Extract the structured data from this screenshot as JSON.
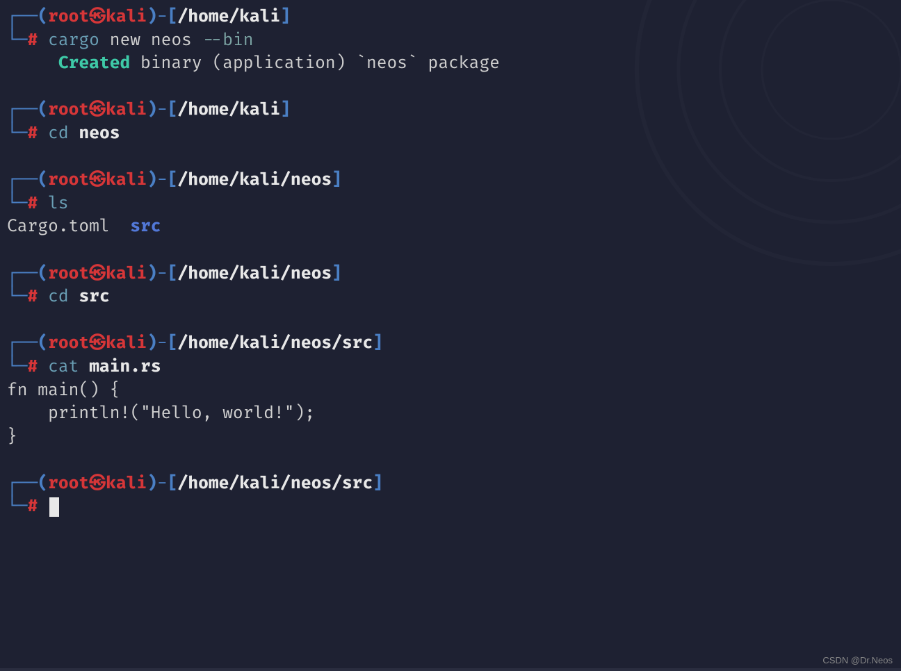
{
  "prompt": {
    "user": "root",
    "host": "kali",
    "corner_top": "┌──",
    "corner_bottom": "└─",
    "paren_open": "(",
    "paren_close": ")",
    "dash": "-",
    "bracket_open": "[",
    "bracket_close": "]",
    "hash": "#",
    "skull": "㉿"
  },
  "blocks": [
    {
      "path": "/home/kali",
      "cmd": "cargo",
      "args_plain": " new neos ",
      "args_flag": "--bin",
      "args_bold": "",
      "output_lines": [
        {
          "prefix": "     ",
          "created": "Created",
          "rest": " binary (application) `neos` package"
        }
      ]
    },
    {
      "path": "/home/kali",
      "cmd": "cd",
      "args_plain": " ",
      "args_flag": "",
      "args_bold": "neos",
      "output_lines": []
    },
    {
      "path": "/home/kali/neos",
      "cmd": "ls",
      "args_plain": "",
      "args_flag": "",
      "args_bold": "",
      "output_lines": [
        {
          "ls_file": "Cargo.toml  ",
          "ls_dir": "src"
        }
      ]
    },
    {
      "path": "/home/kali/neos",
      "cmd": "cd",
      "args_plain": " ",
      "args_flag": "",
      "args_bold": "src",
      "output_lines": []
    },
    {
      "path": "/home/kali/neos/src",
      "cmd": "cat",
      "args_plain": " ",
      "args_flag": "",
      "args_bold": "main.rs",
      "output_lines": [
        {
          "text": "fn main() {"
        },
        {
          "text": "    println!(\"Hello, world!\");"
        },
        {
          "text": "}"
        }
      ]
    },
    {
      "path": "/home/kali/neos/src",
      "cmd": "",
      "args_plain": "",
      "args_flag": "",
      "args_bold": "",
      "cursor": true,
      "output_lines": []
    }
  ],
  "watermark": "CSDN @Dr.Neos"
}
